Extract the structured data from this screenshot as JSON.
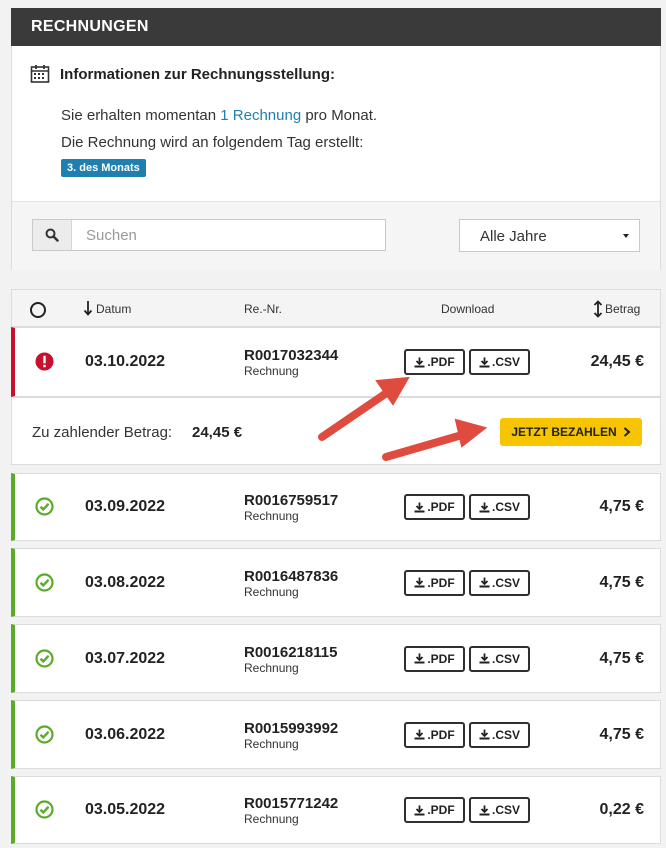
{
  "header": {
    "title": "RECHNUNGEN"
  },
  "info": {
    "title": "Informationen zur Rechnungsstellung:",
    "line1_prefix": "Sie erhalten momentan",
    "line1_highlight": "1 Rechnung",
    "line1_suffix": "pro Monat.",
    "line2": "Die Rechnung wird an folgendem Tag erstellt:",
    "badge": "3. des Monats"
  },
  "search": {
    "placeholder": "Suchen",
    "year_select": "Alle Jahre"
  },
  "table": {
    "headers": {
      "date": "Datum",
      "number": "Re.-Nr.",
      "download": "Download",
      "amount": "Betrag"
    },
    "pdf_label": ".PDF",
    "csv_label": ".CSV",
    "type_label": "Rechnung",
    "rows": [
      {
        "date": "03.10.2022",
        "number": "R0017032344",
        "amount": "24,45 €",
        "status": "unpaid"
      },
      {
        "date": "03.09.2022",
        "number": "R0016759517",
        "amount": "4,75 €",
        "status": "paid"
      },
      {
        "date": "03.08.2022",
        "number": "R0016487836",
        "amount": "4,75 €",
        "status": "paid"
      },
      {
        "date": "03.07.2022",
        "number": "R0016218115",
        "amount": "4,75 €",
        "status": "paid"
      },
      {
        "date": "03.06.2022",
        "number": "R0015993992",
        "amount": "4,75 €",
        "status": "paid"
      },
      {
        "date": "03.05.2022",
        "number": "R0015771242",
        "amount": "0,22 €",
        "status": "paid"
      }
    ]
  },
  "payment": {
    "label": "Zu zahlender Betrag:",
    "amount": "24,45 €",
    "button": "JETZT BEZAHLEN"
  },
  "colors": {
    "accent": "#1f7fb0",
    "paid": "#5aab2a",
    "unpaid": "#c8102e",
    "pay_button": "#f7c500",
    "arrow": "#e04b3f"
  }
}
